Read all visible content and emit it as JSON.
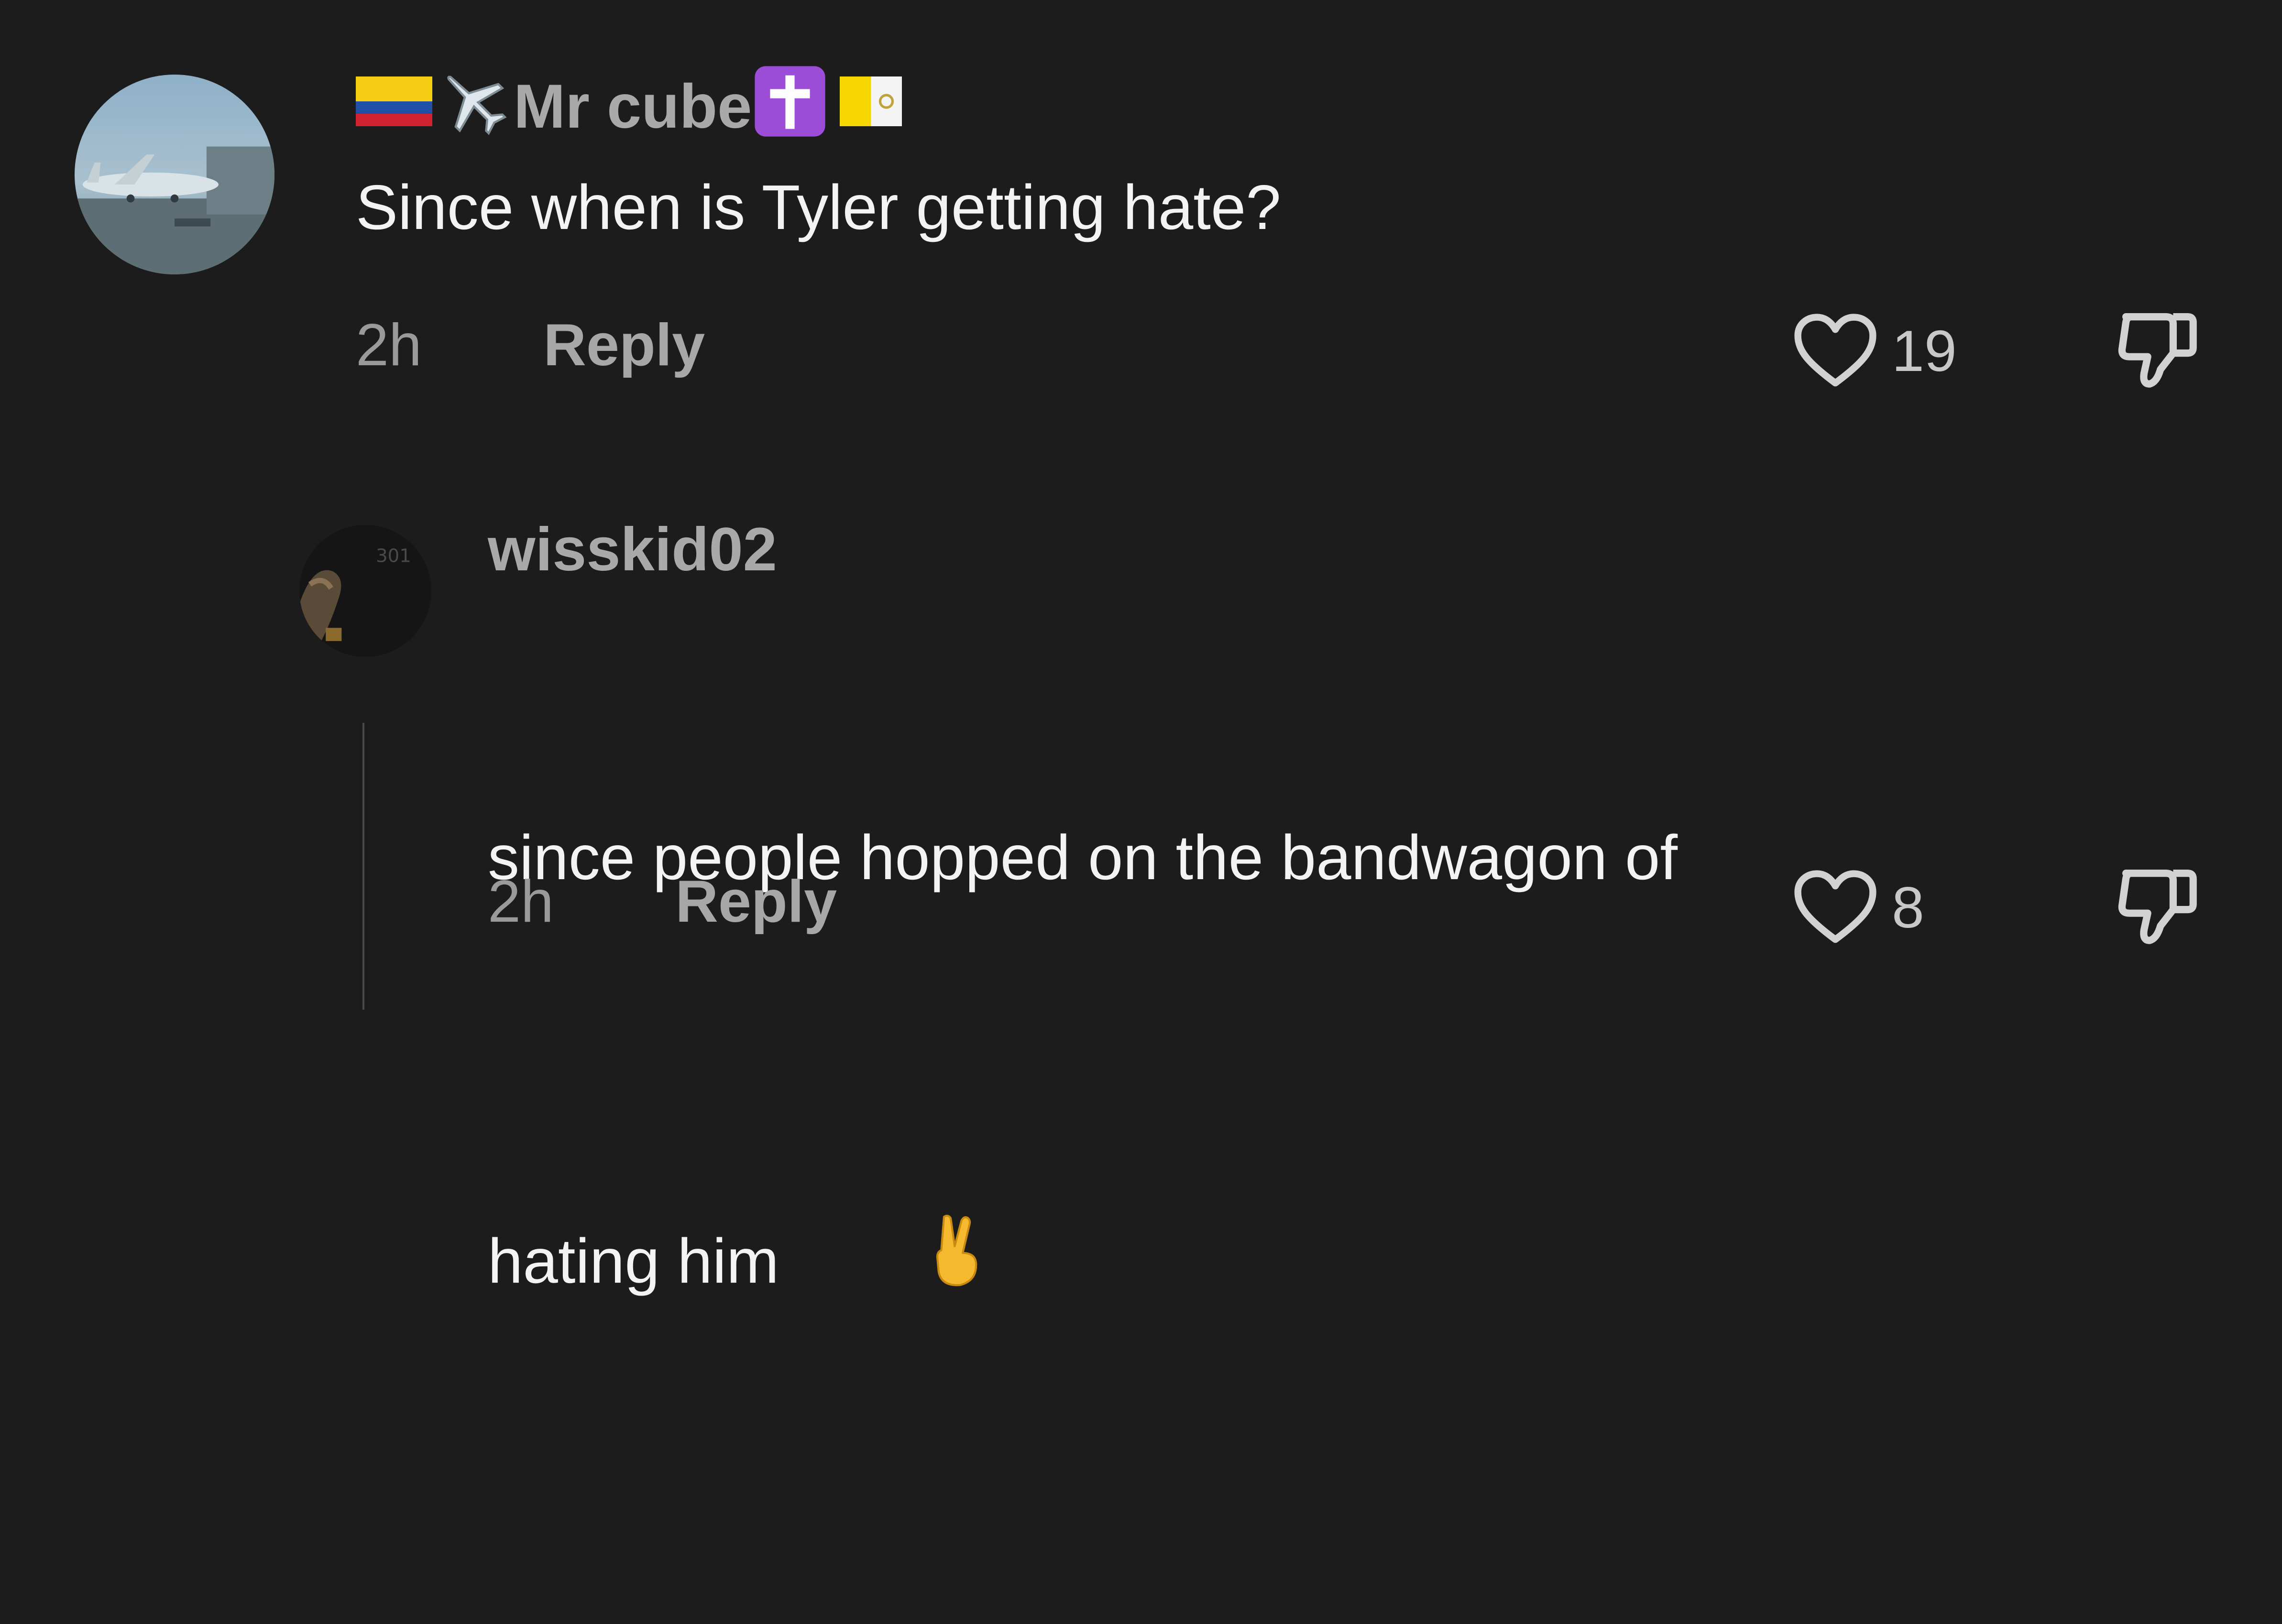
{
  "comments": [
    {
      "username": "Mr cube",
      "username_prefix_icons": [
        "colombia-flag-icon",
        "airplane-icon"
      ],
      "username_suffix_icons": [
        "latin-cross-icon",
        "vatican-flag-icon"
      ],
      "text": "Since when is Tyler getting hate?",
      "time": "2h",
      "reply_label": "Reply",
      "likes": "19",
      "avatar": "airplane-at-gate-photo"
    },
    {
      "username": "wisskid02",
      "text_line1": "since people hopped on the bandwagon of",
      "text_line2": "hating him",
      "text_emoji": "victory-hand-icon",
      "time": "2h",
      "reply_label": "Reply",
      "likes": "8",
      "avatar": "dark-hand-photo"
    }
  ],
  "colors": {
    "background": "#1c1c1c",
    "text_primary": "#f3f3f3",
    "text_secondary": "#a9a9a9"
  }
}
